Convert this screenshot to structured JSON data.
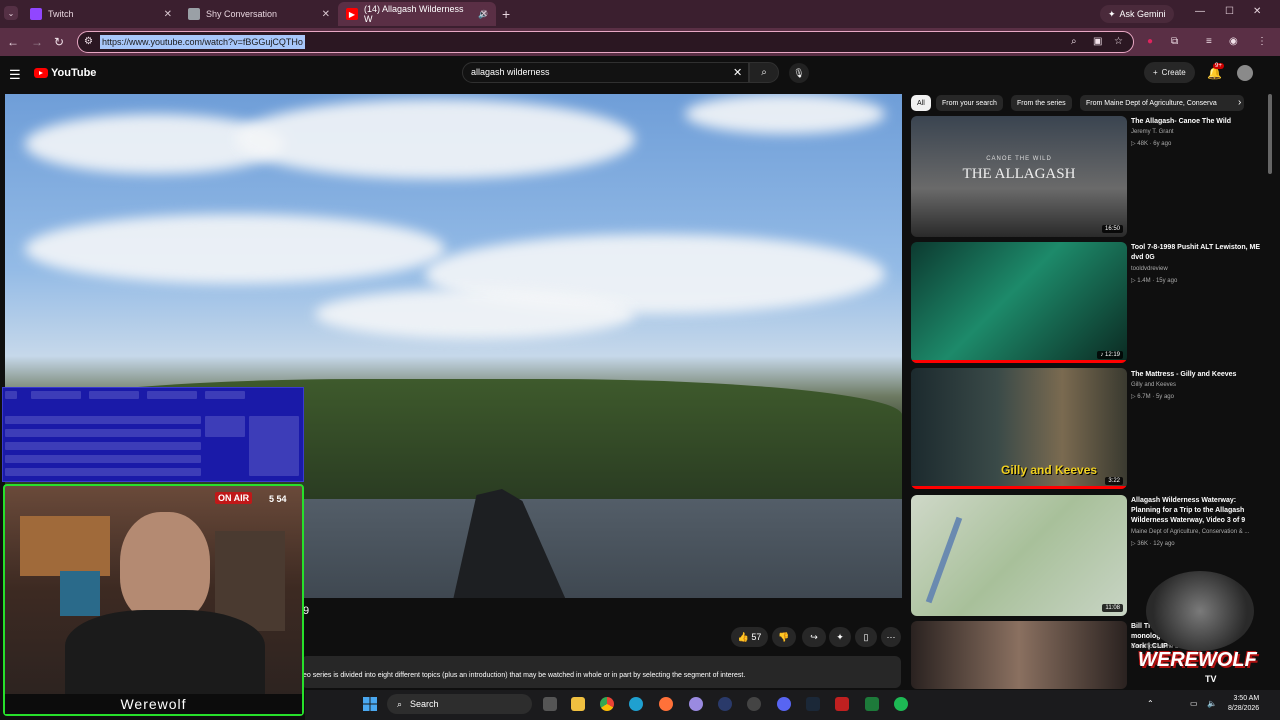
{
  "browser": {
    "tabs": [
      {
        "label": "Twitch",
        "icon": "twitch-icon",
        "color": "#9146ff"
      },
      {
        "label": "Shy Conversation",
        "icon": "page-icon",
        "color": "#9aa0a6"
      },
      {
        "label": "(14) Allagash Wilderness W",
        "icon": "youtube-icon",
        "color": "#ff0000"
      }
    ],
    "new_tab": "+",
    "ask_gemini": "Ask Gemini",
    "url": "https://www.youtube.com/watch?v=fBGGujCQTHo",
    "window_controls": [
      "—",
      "☐",
      "✕"
    ]
  },
  "youtube": {
    "logo_text": "YouTube",
    "search_value": "allagash wilderness",
    "create_label": "Create",
    "notification_count": "9+"
  },
  "video": {
    "title_fragment": "9",
    "like_count": "57",
    "description": "eo series is divided into eight different topics (plus an introduction) that may be watched in whole or in part by selecting the segment of interest."
  },
  "chips": [
    "All",
    "From your search",
    "From the series",
    "From Maine Dept of Agriculture, Conserva"
  ],
  "sidebar": [
    {
      "title": "The Allagash- Canoe The Wild",
      "channel": "Jeremy T. Grant",
      "meta": "▷ 48K · 6y ago",
      "duration": "16:50",
      "thumb_text": "THE ALLAGASH",
      "thumb_sub": "CANOE THE WILD"
    },
    {
      "title": "Tool 7-8-1998 Pushit ALT Lewiston, ME dvd 0G",
      "channel": "tooldvdreview",
      "meta": "▷ 1.4M · 15y ago",
      "duration": "♪ 12:19",
      "progress": 1.0
    },
    {
      "title": "The Mattress - Gilly and Keeves",
      "channel": "Gilly and Keeves",
      "meta": "▷ 6.7M · 5y ago",
      "duration": "3:22",
      "thumb_text": "Gilly and Keeves",
      "progress": 1.0
    },
    {
      "title": "Allagash Wilderness Waterway: Planning for a Trip to the Allagash Wilderness Waterway, Video 3 of 9",
      "channel": "Maine Dept of Agriculture, Conservation & ...",
      "meta": "▷ 36K · 12y ago",
      "duration": "11:08"
    },
    {
      "title": "Bill The Butcher haunting monologue | Gangs of New York | CLIP",
      "channel": "Boxoffice Movie Scenes"
    }
  ],
  "stream_overlay": {
    "on_air": "ON AIR",
    "time": "5 54",
    "name": "Werewolf",
    "logo_text": "WEREWOLF",
    "logo_sub": "TV"
  },
  "taskbar": {
    "search_label": "Search",
    "time": "3:50 AM",
    "date": "8/28/2026"
  }
}
